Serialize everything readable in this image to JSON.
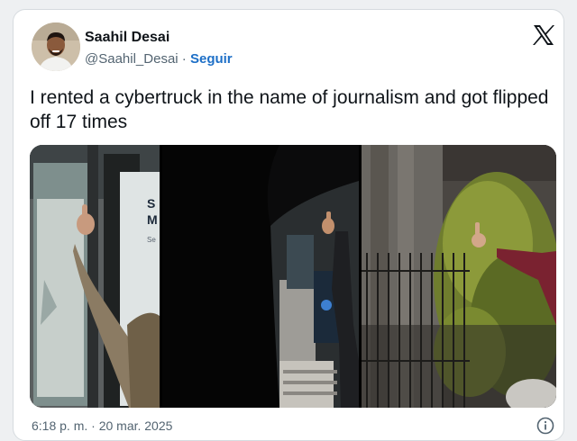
{
  "author": {
    "name": "Saahil Desai",
    "handle": "@Saahil_Desai",
    "separator": "·",
    "follow_label": "Seguir"
  },
  "tweet": {
    "text": "I rented a cybertruck in the name of journalism and got flipped off 17 times"
  },
  "media": {
    "photo1_sign_text": "S\nM",
    "photo1_sign_sub": "Se"
  },
  "footer": {
    "timestamp": "6:18 p. m. · 20 mar. 2025"
  },
  "icons": {
    "brand": "x-logo-icon",
    "info": "info-icon"
  },
  "colors": {
    "follow_link": "#1d6fc7",
    "text_primary": "#0f1419",
    "text_secondary": "#536471"
  }
}
